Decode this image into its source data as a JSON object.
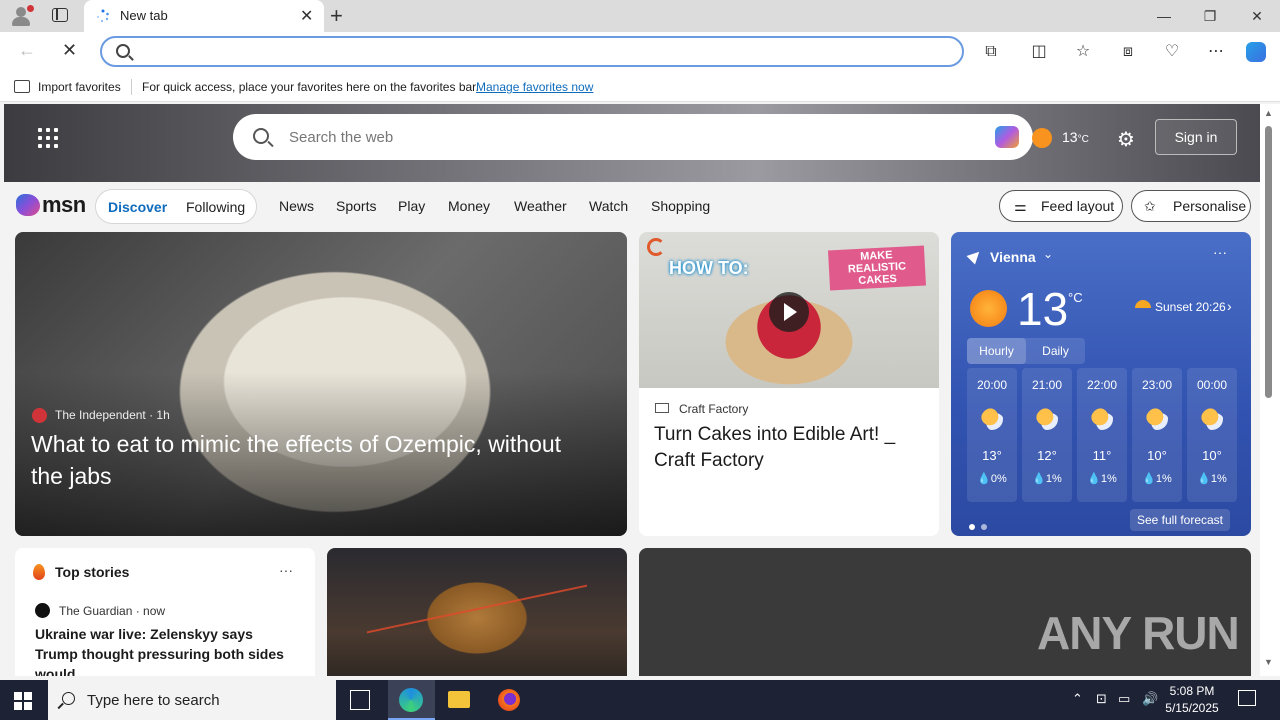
{
  "browser": {
    "tab_title": "New tab",
    "address_value": "",
    "favorites_bar": {
      "import_label": "Import favorites",
      "message": "For quick access, place your favorites here on the favorites bar.",
      "manage_link": "Manage favorites now"
    }
  },
  "msn": {
    "search_placeholder": "Search the web",
    "header_temp": "13",
    "header_temp_unit": "°C",
    "sign_in": "Sign in",
    "logo_text": "msn",
    "pills": [
      "Discover",
      "Following"
    ],
    "nav": [
      "News",
      "Sports",
      "Play",
      "Money",
      "Weather",
      "Watch",
      "Shopping"
    ],
    "feed_layout": "Feed layout",
    "personalise": "Personalise"
  },
  "main_story": {
    "source": "The Independent · 1h",
    "headline": "What to eat to mimic the effects of Ozempic, without the jabs"
  },
  "video_story": {
    "thumb_howto": "HOW TO:",
    "thumb_caption": "MAKE REALISTIC CAKES",
    "source": "Craft Factory",
    "headline": "Turn Cakes into Edible Art! _ Craft Factory"
  },
  "weather": {
    "location": "Vienna",
    "temp": "13",
    "unit": "°C",
    "sunset": "Sunset 20:26",
    "tab_hourly": "Hourly",
    "tab_daily": "Daily",
    "hours": [
      {
        "time": "20:00",
        "temp": "13°",
        "precip": "0%"
      },
      {
        "time": "21:00",
        "temp": "12°",
        "precip": "1%"
      },
      {
        "time": "22:00",
        "temp": "11°",
        "precip": "1%"
      },
      {
        "time": "23:00",
        "temp": "10°",
        "precip": "1%"
      },
      {
        "time": "00:00",
        "temp": "10°",
        "precip": "1%"
      }
    ],
    "see_forecast": "See full forecast"
  },
  "top_stories": {
    "title": "Top stories",
    "source": "The Guardian · now",
    "headline": "Ukraine war live: Zelenskyy says Trump thought pressuring both sides would..."
  },
  "watermark": "ANY RUN",
  "taskbar": {
    "search_placeholder": "Type here to search",
    "time": "5:08 PM",
    "date": "5/15/2025"
  },
  "colors": {
    "accent": "#0f6cbd",
    "weather_bg": "#3152b0",
    "taskbar_bg": "#1e2235"
  }
}
